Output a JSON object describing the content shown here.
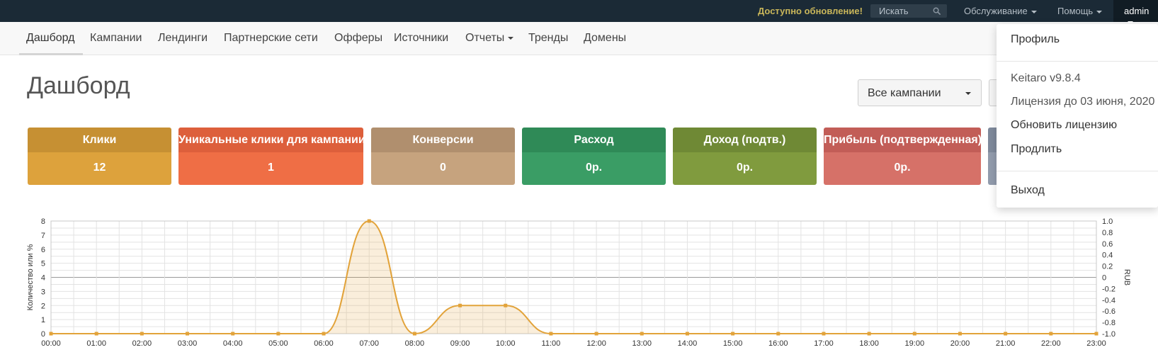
{
  "topbar": {
    "update_notice": "Доступно обновление!",
    "search_placeholder": "Искать",
    "menu_service": "Обслуживание",
    "menu_help": "Помощь",
    "menu_user": "admin"
  },
  "nav": {
    "items": [
      "Дашборд",
      "Кампании",
      "Лендинги",
      "Партнерские сети",
      "Офферы",
      "Источники",
      "Отчеты",
      "Тренды",
      "Домены"
    ]
  },
  "page": {
    "title": "Дашборд",
    "campaign_select": "Все кампании"
  },
  "cards": [
    {
      "label": "Клики",
      "value": "12",
      "head_color": "#c69033",
      "body_color": "#dda23c"
    },
    {
      "label": "Уникальные клики для кампании",
      "value": "1",
      "head_color": "#dd5f3b",
      "body_color": "#ef6e45"
    },
    {
      "label": "Конверсии",
      "value": "0",
      "head_color": "#b08f6e",
      "body_color": "#c6a37e"
    },
    {
      "label": "Расход",
      "value": "0р.",
      "head_color": "#2f8a57",
      "body_color": "#3a9d65"
    },
    {
      "label": "Доход (подтв.)",
      "value": "0р.",
      "head_color": "#6f8935",
      "body_color": "#809b3e"
    },
    {
      "label": "Прибыль (подтвержденная)",
      "value": "0р.",
      "head_color": "#c25d57",
      "body_color": "#d67168"
    },
    {
      "label": "",
      "value": "",
      "head_color": "#7f8a9c",
      "body_color": "#929cad"
    }
  ],
  "dropdown": {
    "profile": "Профиль",
    "version": "Keitaro v9.8.4",
    "license": "Лицензия до 03 июня, 2020",
    "renew": "Обновить лицензию",
    "extend": "Продлить",
    "logout": "Выход"
  },
  "chart_data": {
    "type": "area",
    "x": [
      "00:00",
      "01:00",
      "02:00",
      "03:00",
      "04:00",
      "05:00",
      "06:00",
      "07:00",
      "08:00",
      "09:00",
      "10:00",
      "11:00",
      "12:00",
      "13:00",
      "14:00",
      "15:00",
      "16:00",
      "17:00",
      "18:00",
      "19:00",
      "20:00",
      "21:00",
      "22:00",
      "23:00"
    ],
    "series": [
      {
        "values": [
          0,
          0,
          0,
          0,
          0,
          0,
          0,
          8,
          0,
          2,
          2,
          0,
          0,
          0,
          0,
          0,
          0,
          0,
          0,
          0,
          0,
          0,
          0,
          0
        ],
        "color": "#e2a33a"
      }
    ],
    "ylabel": "Количество или %",
    "y2label": "RUB",
    "ylim": [
      0,
      8
    ],
    "y2lim": [
      -1.0,
      1.0
    ],
    "yticks": [
      "0",
      "1",
      "2",
      "3",
      "4",
      "5",
      "6",
      "7",
      "8"
    ],
    "y2ticks": [
      "-1.0",
      "-0.8",
      "-0.6",
      "-0.4",
      "-0.2",
      "0",
      "0.2",
      "0.4",
      "0.6",
      "0.8",
      "1.0"
    ],
    "grid": true
  }
}
